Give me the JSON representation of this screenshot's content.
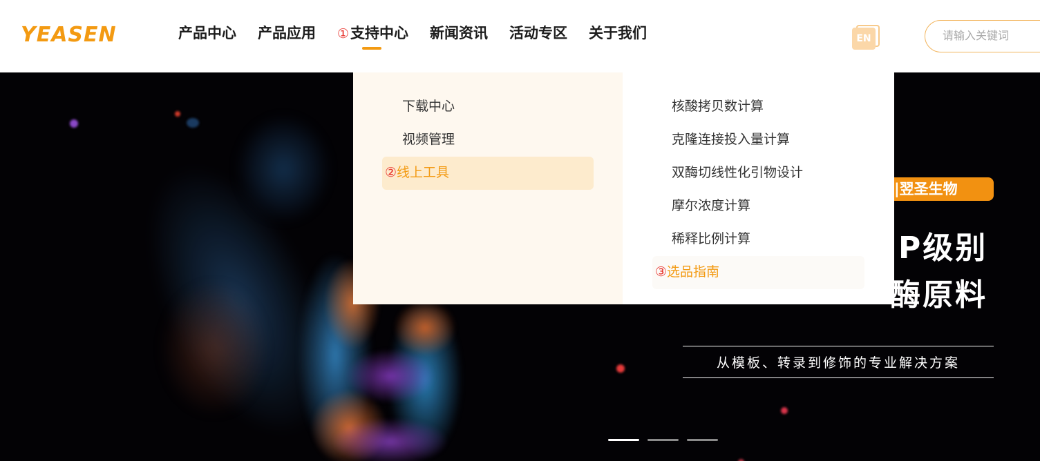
{
  "header": {
    "logo_text": "YEASEN",
    "nav": [
      {
        "label": "产品中心",
        "marker": ""
      },
      {
        "label": "产品应用",
        "marker": ""
      },
      {
        "label": "支持中心",
        "marker": "①"
      },
      {
        "label": "新闻资讯",
        "marker": ""
      },
      {
        "label": "活动专区",
        "marker": ""
      },
      {
        "label": "关于我们",
        "marker": ""
      }
    ],
    "lang_label": "EN",
    "search_placeholder": "请输入关键词"
  },
  "dropdown": {
    "left_items": [
      {
        "label": "下载中心",
        "marker": ""
      },
      {
        "label": "视频管理",
        "marker": ""
      },
      {
        "label": "线上工具",
        "marker": "②"
      }
    ],
    "right_items": [
      {
        "label": "核酸拷贝数计算",
        "marker": ""
      },
      {
        "label": "克隆连接投入量计算",
        "marker": ""
      },
      {
        "label": "双酶切线性化引物设计",
        "marker": ""
      },
      {
        "label": "摩尔浓度计算",
        "marker": ""
      },
      {
        "label": "稀释比例计算",
        "marker": ""
      },
      {
        "label": "选品指南",
        "marker": "③"
      }
    ]
  },
  "hero": {
    "brand_tag": "|翌圣生物",
    "headline_line1": "P级别",
    "headline_line2": "酶原料",
    "subtitle": "从模板、转录到修饰的专业解决方案"
  },
  "colors": {
    "accent": "#f39a12",
    "marker_red": "#e8302a",
    "dropdown_left_bg": "#fef8ef"
  }
}
